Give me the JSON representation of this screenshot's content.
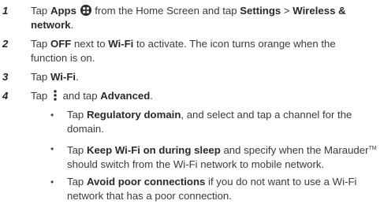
{
  "steps": [
    {
      "number": "1",
      "p1": "Tap ",
      "b1": "Apps",
      "p2": " from the Home Screen and tap ",
      "b2": "Settings",
      "p3": " > ",
      "b3": "Wireless &",
      "b3_cont": "network",
      "p4": ".",
      "icon": "apps-grid-icon"
    },
    {
      "number": "2",
      "p1": "Tap ",
      "b1": "OFF",
      "p2": " next to ",
      "b2": "Wi-Fi",
      "p3": " to activate. The icon turns orange when the",
      "line2": "function is on."
    },
    {
      "number": "3",
      "p1": "Tap ",
      "b1": "Wi-Fi",
      "p2": "."
    },
    {
      "number": "4",
      "p1": "Tap ",
      "p2": " and tap ",
      "b1": "Advanced",
      "p3": ".",
      "icon": "overflow-menu-icon"
    }
  ],
  "bullets": [
    {
      "symbol": "•",
      "p1": "Tap ",
      "b1": "Regulatory domain",
      "p2": ", and select and tap a channel for the",
      "line2": "domain."
    },
    {
      "symbol": "•",
      "p1": "Tap ",
      "b1": "Keep Wi-Fi on during sleep",
      "p2": " and specify when the Marauder",
      "tm": "TM",
      "line2": "should switch from the Wi-Fi network to mobile network."
    },
    {
      "symbol": "•",
      "p1": "Tap ",
      "b1": "Avoid poor connections",
      "p2": " if you do not want to use a Wi-Fi",
      "line2": "network that has a poor connection."
    }
  ]
}
